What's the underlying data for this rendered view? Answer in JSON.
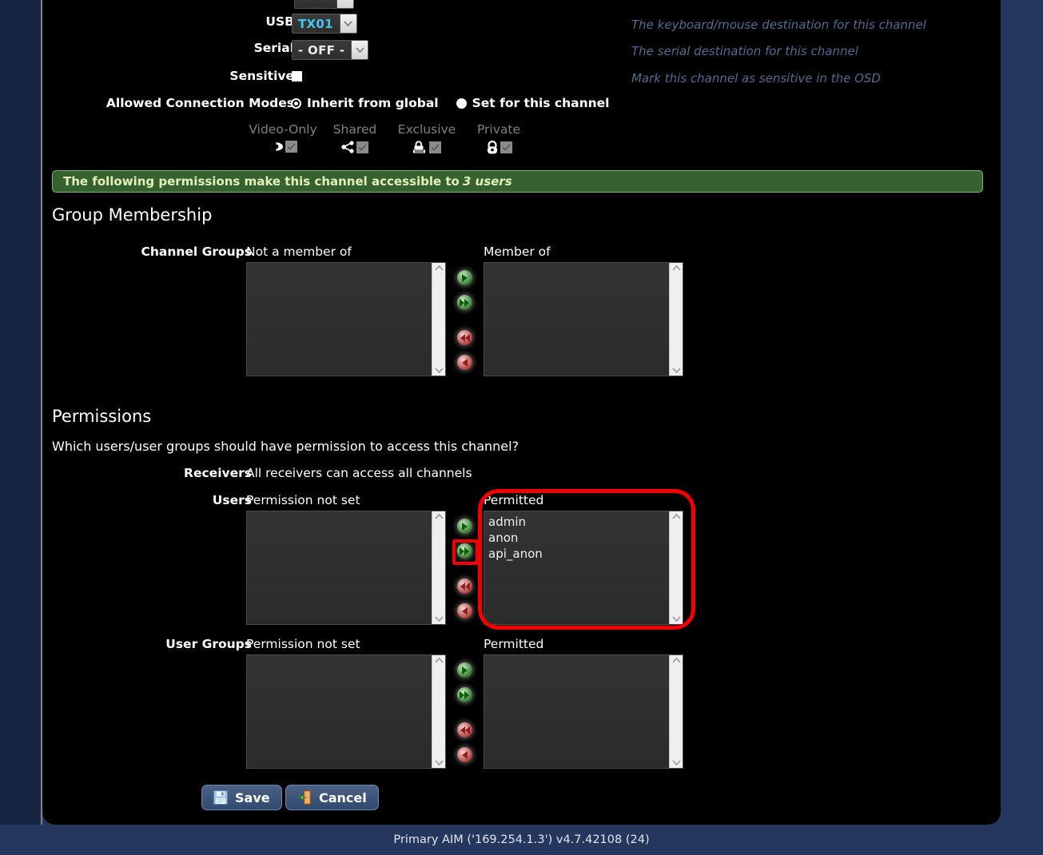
{
  "form": {
    "rows": [
      {
        "label": "USB",
        "value": "TX01",
        "help": "The keyboard/mouse destination for this channel"
      },
      {
        "label": "Serial",
        "value": "- OFF -",
        "help": "The serial destination for this channel"
      }
    ],
    "sensitive": {
      "label": "Sensitive",
      "help": "Mark this channel as sensitive in the OSD",
      "checked": false
    },
    "connection_modes": {
      "label": "Allowed Connection Modes",
      "options": [
        {
          "label": "Inherit from global",
          "selected": false
        },
        {
          "label": "Set for this channel",
          "selected": true
        }
      ],
      "modes": [
        {
          "name": "Video-Only",
          "icon": "eye-icon",
          "checked": false
        },
        {
          "name": "Shared",
          "icon": "share-icon",
          "checked": false
        },
        {
          "name": "Exclusive",
          "icon": "keyboard-lock-icon",
          "checked": false
        },
        {
          "name": "Private",
          "icon": "lock-icon",
          "checked": false
        }
      ]
    }
  },
  "banner": {
    "text": "The following permissions make this channel accessible to",
    "count": "3 users"
  },
  "group_membership": {
    "heading": "Group Membership",
    "row_label": "Channel Groups",
    "left_header": "Not a member of",
    "right_header": "Member of",
    "left_items": [],
    "right_items": []
  },
  "permissions": {
    "heading": "Permissions",
    "question": "Which users/user groups should have permission to access this channel?",
    "receivers": {
      "label": "Receivers",
      "text": "All receivers can access all channels"
    },
    "users": {
      "row_label": "Users",
      "left_header": "Permission not set",
      "right_header": "Permitted",
      "left_items": [],
      "right_items": [
        "admin",
        "anon",
        "api_anon"
      ]
    },
    "user_groups": {
      "row_label": "User Groups",
      "left_header": "Permission not set",
      "right_header": "Permitted",
      "left_items": [],
      "right_items": []
    }
  },
  "transfer_buttons": [
    {
      "name": "move-right",
      "glyph": "▶",
      "color": "green"
    },
    {
      "name": "move-all-right",
      "glyph": "▶▶",
      "color": "green"
    },
    {
      "name": "move-all-left",
      "glyph": "◀◀",
      "color": "red"
    },
    {
      "name": "move-left",
      "glyph": "◀",
      "color": "red"
    }
  ],
  "actions": {
    "save": "Save",
    "cancel": "Cancel"
  },
  "footer": {
    "text": "Primary AIM ('169.254.1.3') v4.7.42108 (24)"
  },
  "colors": {
    "page_background": "#26375e",
    "panel_background": "#000000",
    "banner_background": "#35622f",
    "banner_text": "#e3f0b9",
    "help_text": "#4f6d92",
    "highlight": "#f50000",
    "select_value": "#46c8f0"
  }
}
